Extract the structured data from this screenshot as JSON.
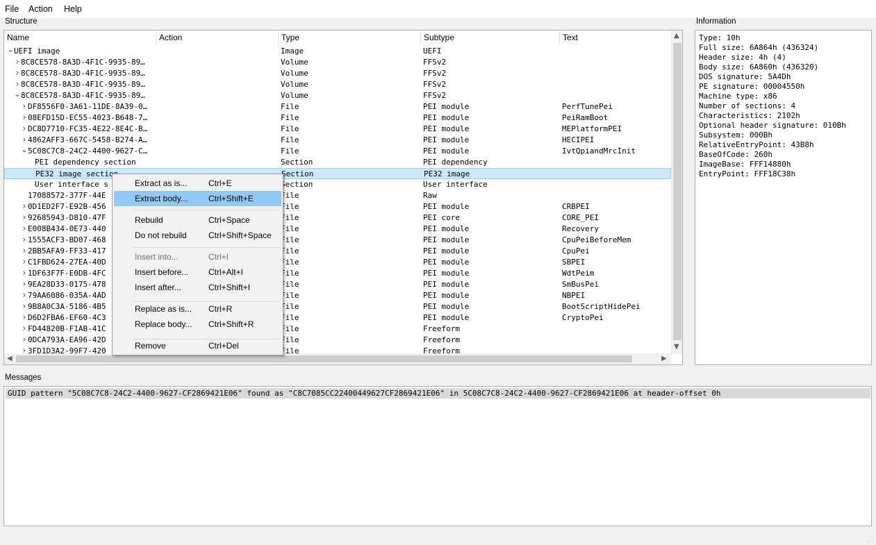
{
  "menubar": {
    "file": "File",
    "action": "Action",
    "help": "Help"
  },
  "structure": {
    "label": "Structure",
    "columns": {
      "name": "Name",
      "action": "Action",
      "type": "Type",
      "subtype": "Subtype",
      "text": "Text"
    },
    "rows": [
      {
        "d": 0,
        "a": "down",
        "name": "UEFI image",
        "action": "",
        "type": "Image",
        "subtype": "UEFI",
        "text": ""
      },
      {
        "d": 1,
        "a": "right",
        "name": "8C8CE578-8A3D-4F1C-9935-89…",
        "action": "",
        "type": "Volume",
        "subtype": "FFSv2",
        "text": ""
      },
      {
        "d": 1,
        "a": "right",
        "name": "8C8CE578-8A3D-4F1C-9935-89…",
        "action": "",
        "type": "Volume",
        "subtype": "FFSv2",
        "text": ""
      },
      {
        "d": 1,
        "a": "right",
        "name": "8C8CE578-8A3D-4F1C-9935-89…",
        "action": "",
        "type": "Volume",
        "subtype": "FFSv2",
        "text": ""
      },
      {
        "d": 1,
        "a": "down",
        "name": "8C8CE578-8A3D-4F1C-9935-89…",
        "action": "",
        "type": "Volume",
        "subtype": "FFSv2",
        "text": ""
      },
      {
        "d": 2,
        "a": "right",
        "name": "DF8556F0-3A61-11DE-8A39-0…",
        "action": "",
        "type": "File",
        "subtype": "PEI module",
        "text": "PerfTunePei"
      },
      {
        "d": 2,
        "a": "right",
        "name": "08EFD15D-EC55-4023-B648-7…",
        "action": "",
        "type": "File",
        "subtype": "PEI module",
        "text": "PeiRamBoot"
      },
      {
        "d": 2,
        "a": "right",
        "name": "DC8D7710-FC35-4E22-8E4C-B…",
        "action": "",
        "type": "File",
        "subtype": "PEI module",
        "text": "MEPlatformPEI"
      },
      {
        "d": 2,
        "a": "right",
        "name": "4862AFF3-667C-5458-B274-A…",
        "action": "",
        "type": "File",
        "subtype": "PEI module",
        "text": "HECIPEI"
      },
      {
        "d": 2,
        "a": "down",
        "name": "5C08C7C8-24C2-4400-9627-C…",
        "action": "",
        "type": "File",
        "subtype": "PEI module",
        "text": "IvtQpiandMrcInit"
      },
      {
        "d": 3,
        "a": "",
        "name": "PEI dependency section",
        "action": "",
        "type": "Section",
        "subtype": "PEI dependency",
        "text": ""
      },
      {
        "d": 3,
        "a": "",
        "name": "PE32 image section",
        "action": "",
        "type": "Section",
        "subtype": "PE32 image",
        "text": "",
        "selected": true
      },
      {
        "d": 3,
        "a": "",
        "name": "User interface s",
        "action": "",
        "type": "Section",
        "subtype": "User interface",
        "text": ""
      },
      {
        "d": 2,
        "a": "",
        "name": "17088572-377F-44E",
        "action": "",
        "type": "File",
        "subtype": "Raw",
        "text": ""
      },
      {
        "d": 2,
        "a": "right",
        "name": "0D1ED2F7-E92B-456",
        "action": "",
        "type": "File",
        "subtype": "PEI module",
        "text": "CRBPEI"
      },
      {
        "d": 2,
        "a": "right",
        "name": "92685943-D810-47F",
        "action": "",
        "type": "File",
        "subtype": "PEI core",
        "text": "CORE_PEI"
      },
      {
        "d": 2,
        "a": "right",
        "name": "E008B434-0E73-440",
        "action": "",
        "type": "File",
        "subtype": "PEI module",
        "text": "Recovery"
      },
      {
        "d": 2,
        "a": "right",
        "name": "1555ACF3-BD07-468",
        "action": "",
        "type": "File",
        "subtype": "PEI module",
        "text": "CpuPeiBeforeMem"
      },
      {
        "d": 2,
        "a": "right",
        "name": "2BB5AFA9-FF33-417",
        "action": "",
        "type": "File",
        "subtype": "PEI module",
        "text": "CpuPei"
      },
      {
        "d": 2,
        "a": "right",
        "name": "C1FBD624-27EA-40D",
        "action": "",
        "type": "File",
        "subtype": "PEI module",
        "text": "SBPEI"
      },
      {
        "d": 2,
        "a": "right",
        "name": "1DF63F7F-E0DB-4FC",
        "action": "",
        "type": "File",
        "subtype": "PEI module",
        "text": "WdtPeim"
      },
      {
        "d": 2,
        "a": "right",
        "name": "9EA28D33-0175-478",
        "action": "",
        "type": "File",
        "subtype": "PEI module",
        "text": "SmBusPei"
      },
      {
        "d": 2,
        "a": "right",
        "name": "79AA6086-035A-4AD",
        "action": "",
        "type": "File",
        "subtype": "PEI module",
        "text": "NBPEI"
      },
      {
        "d": 2,
        "a": "right",
        "name": "9B8A0C3A-5186-4B5",
        "action": "",
        "type": "File",
        "subtype": "PEI module",
        "text": "BootScriptHidePei"
      },
      {
        "d": 2,
        "a": "right",
        "name": "D6D2FBA6-EF60-4C3",
        "action": "",
        "type": "File",
        "subtype": "PEI module",
        "text": "CryptoPei"
      },
      {
        "d": 2,
        "a": "right",
        "name": "FD44820B-F1AB-41C",
        "action": "",
        "type": "File",
        "subtype": "Freeform",
        "text": ""
      },
      {
        "d": 2,
        "a": "right",
        "name": "0DCA793A-EA96-42D",
        "action": "",
        "type": "File",
        "subtype": "Freeform",
        "text": ""
      },
      {
        "d": 2,
        "a": "right",
        "name": "3FD1D3A2-99F7-420",
        "action": "",
        "type": "File",
        "subtype": "Freeform",
        "text": ""
      }
    ]
  },
  "information": {
    "label": "Information",
    "lines": [
      "Type: 10h",
      "Full size: 6A864h (436324)",
      "Header size: 4h (4)",
      "Body size: 6A860h (436320)",
      "DOS signature: 5A4Dh",
      "PE signature: 00004550h",
      "Machine type: x86",
      "Number of sections: 4",
      "Characteristics: 2102h",
      "Optional header signature: 010Bh",
      "Subsystem: 000Bh",
      "RelativeEntryPoint: 43B8h",
      "BaseOfCode: 260h",
      "ImageBase: FFF14880h",
      "EntryPoint: FFF18C38h"
    ]
  },
  "messages": {
    "label": "Messages",
    "items": [
      "GUID pattern \"5C08C7C8-24C2-4400-9627-CF2869421E06\" found as \"C8C7085CC22400449627CF2869421E06\" in 5C08C7C8-24C2-4400-9627-CF2869421E06 at header-offset 0h"
    ]
  },
  "context_menu": {
    "items": [
      {
        "label": "Extract as is...",
        "shortcut": "Ctrl+E",
        "disabled": false,
        "highlighted": false
      },
      {
        "label": "Extract body...",
        "shortcut": "Ctrl+Shift+E",
        "disabled": false,
        "highlighted": true
      },
      {
        "label": "Rebuild",
        "shortcut": "Ctrl+Space",
        "disabled": false,
        "highlighted": false
      },
      {
        "label": "Do not rebuild",
        "shortcut": "Ctrl+Shift+Space",
        "disabled": false,
        "highlighted": false
      },
      {
        "label": "Insert into...",
        "shortcut": "Ctrl+I",
        "disabled": true,
        "highlighted": false
      },
      {
        "label": "Insert before...",
        "shortcut": "Ctrl+Alt+I",
        "disabled": false,
        "highlighted": false
      },
      {
        "label": "Insert after...",
        "shortcut": "Ctrl+Shift+I",
        "disabled": false,
        "highlighted": false
      },
      {
        "label": "Replace as is...",
        "shortcut": "Ctrl+R",
        "disabled": false,
        "highlighted": false
      },
      {
        "label": "Replace body...",
        "shortcut": "Ctrl+Shift+R",
        "disabled": false,
        "highlighted": false
      },
      {
        "label": "Remove",
        "shortcut": "Ctrl+Del",
        "disabled": false,
        "highlighted": false
      }
    ]
  },
  "colors": {
    "selection": "#cce8ff",
    "menu_highlight": "#91c9f7",
    "message_highlight": "#d9d9d9"
  }
}
